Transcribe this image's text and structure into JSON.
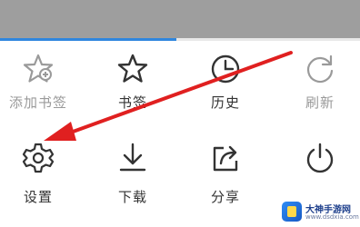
{
  "menu": {
    "row1": [
      {
        "label": "添加书签",
        "icon": "star-plus-icon"
      },
      {
        "label": "书签",
        "icon": "star-icon"
      },
      {
        "label": "历史",
        "icon": "clock-icon"
      },
      {
        "label": "刷新",
        "icon": "refresh-icon"
      }
    ],
    "row2": [
      {
        "label": "设置",
        "icon": "gear-icon"
      },
      {
        "label": "下载",
        "icon": "download-icon"
      },
      {
        "label": "分享",
        "icon": "share-icon"
      },
      {
        "label": "",
        "icon": "power-icon"
      }
    ]
  },
  "annotation": {
    "color": "#e02020"
  },
  "page_progress": 0.49,
  "watermark": {
    "title": "大神手游网",
    "subtitle": "www.dsdxia.com"
  },
  "colors": {
    "progress": "#2f86de",
    "icon": "#333333",
    "dim": "#9a9a9a"
  }
}
